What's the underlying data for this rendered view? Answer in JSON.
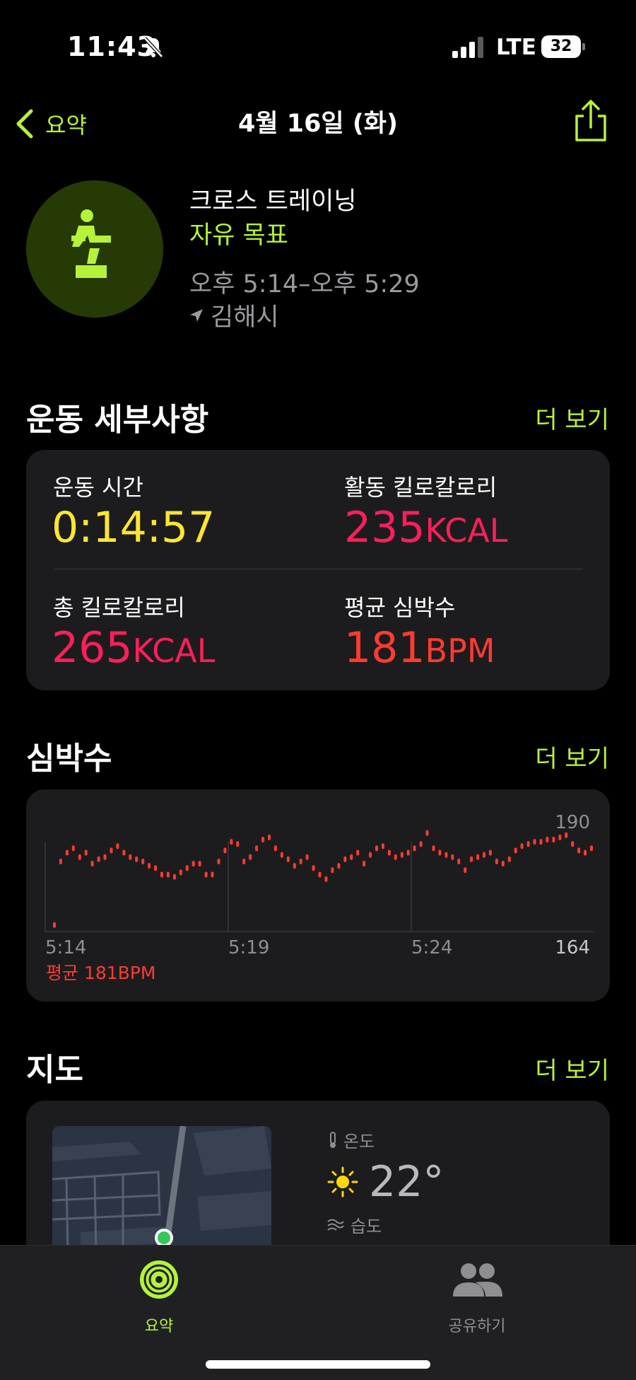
{
  "status_bar": {
    "time": "11:43",
    "network": "LTE",
    "battery": "32"
  },
  "nav": {
    "back_label": "요약",
    "title": "4월 16일 (화)"
  },
  "workout": {
    "name": "크로스 트레이닝",
    "goal": "자유 목표",
    "time_range": "오후 5:14–오후 5:29",
    "location": "김해시"
  },
  "details": {
    "title": "운동 세부사항",
    "more": "더 보기",
    "duration_label": "운동 시간",
    "duration_value": "0:14:57",
    "active_kcal_label": "활동 킬로칼로리",
    "active_kcal_value": "235",
    "active_kcal_unit": "KCAL",
    "total_kcal_label": "총 킬로칼로리",
    "total_kcal_value": "265",
    "total_kcal_unit": "KCAL",
    "avg_hr_label": "평균 심박수",
    "avg_hr_value": "181",
    "avg_hr_unit": "BPM"
  },
  "heart": {
    "title": "심박수",
    "more": "더 보기",
    "avg_label": "평균 181BPM"
  },
  "chart_data": {
    "type": "scatter",
    "x_tick_labels": [
      "5:14",
      "5:19",
      "5:24"
    ],
    "y_tick_labels": [
      "190",
      "164"
    ],
    "ylim": [
      164,
      190
    ],
    "values": [
      165.5,
      180,
      182,
      183,
      181,
      182,
      179.5,
      180.5,
      181,
      182.5,
      183.5,
      182,
      181,
      180.5,
      180,
      179,
      178.5,
      177,
      177,
      176.5,
      177.5,
      178.5,
      179.5,
      179.5,
      177,
      177,
      180,
      182.5,
      184.5,
      184,
      180,
      181,
      183,
      185,
      185.5,
      183,
      181.5,
      180.5,
      179,
      180,
      181,
      178.5,
      177,
      176,
      178,
      179,
      180.5,
      181,
      182,
      179.5,
      181.5,
      183,
      183.5,
      182,
      181,
      181.5,
      182,
      183,
      184,
      186.5,
      183,
      182,
      181.5,
      181,
      180,
      178,
      180.5,
      181,
      181.5,
      182,
      180,
      179.5,
      180.5,
      182.5,
      183.5,
      184,
      184.5,
      184.5,
      185,
      185,
      185.5,
      186,
      184,
      182.5,
      182,
      183
    ]
  },
  "map_section": {
    "title": "지도",
    "more": "더 보기",
    "temp_label": "온도",
    "temp_value": "22°",
    "humidity_label": "습도"
  },
  "tabs": [
    {
      "label": "요약"
    },
    {
      "label": "공유하기"
    }
  ],
  "colors": {
    "accent": "#b5f23a",
    "kcal": "#fa1f5a",
    "hr": "#ff3b30",
    "duration": "#fde62f"
  }
}
